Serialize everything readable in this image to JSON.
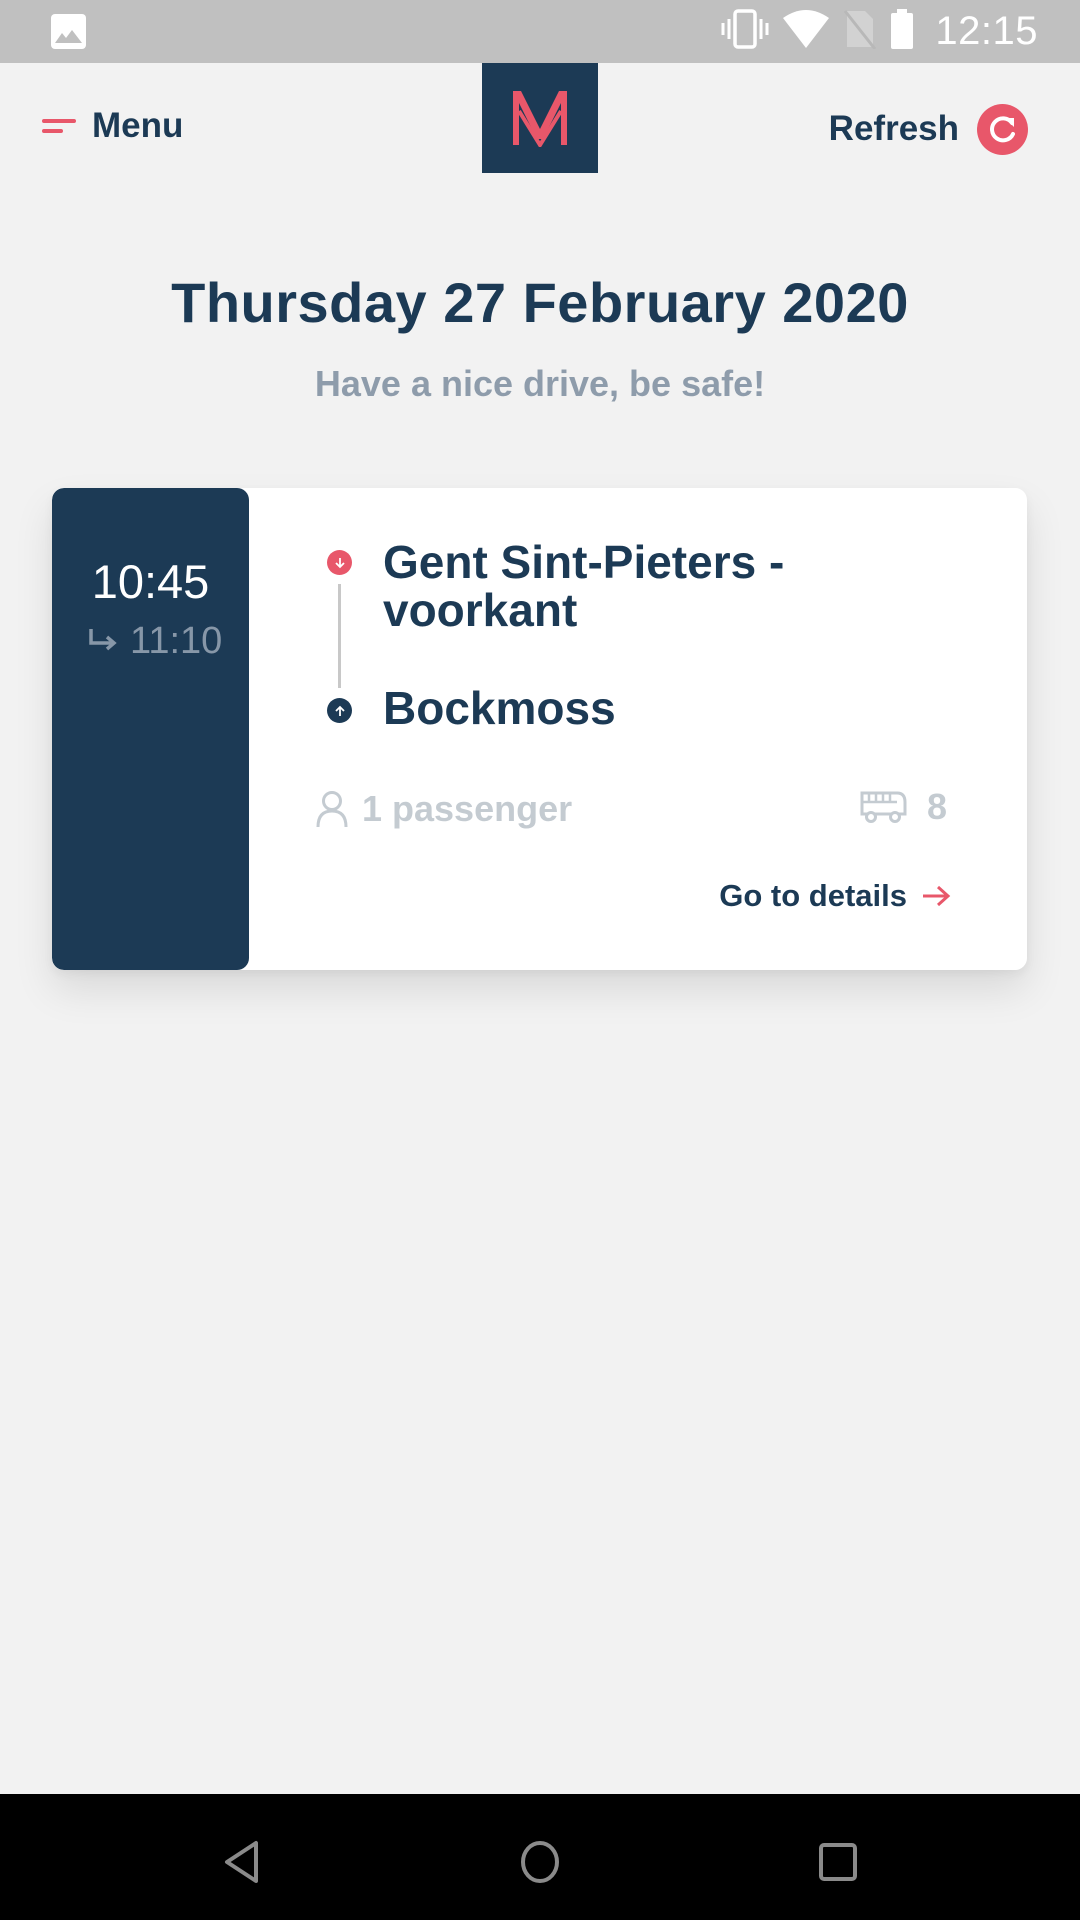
{
  "status_bar": {
    "time": "12:15",
    "icons": [
      "gallery-icon",
      "vibrate-icon",
      "wifi-icon",
      "no-sim-icon",
      "battery-icon"
    ]
  },
  "header": {
    "menu_label": "Menu",
    "logo_letter": "M",
    "refresh_label": "Refresh"
  },
  "page": {
    "date_title": "Thursday 27 February 2020",
    "subtitle": "Have a nice drive, be safe!"
  },
  "ride": {
    "start_time": "10:45",
    "end_time": "11:10",
    "from": "Gent Sint-Pieters - voorkant",
    "to": "Bockmoss",
    "passengers": "1 passenger",
    "vehicle_number": "8",
    "details_label": "Go to details"
  },
  "colors": {
    "brand_navy": "#1c3a55",
    "accent_red": "#e8576a",
    "muted_gray": "#c4cbd1",
    "subtitle_gray": "#8e9cab",
    "background": "#f2f2f2"
  },
  "nav_bar": {
    "buttons": [
      "back-icon",
      "home-icon",
      "recent-apps-icon"
    ]
  }
}
